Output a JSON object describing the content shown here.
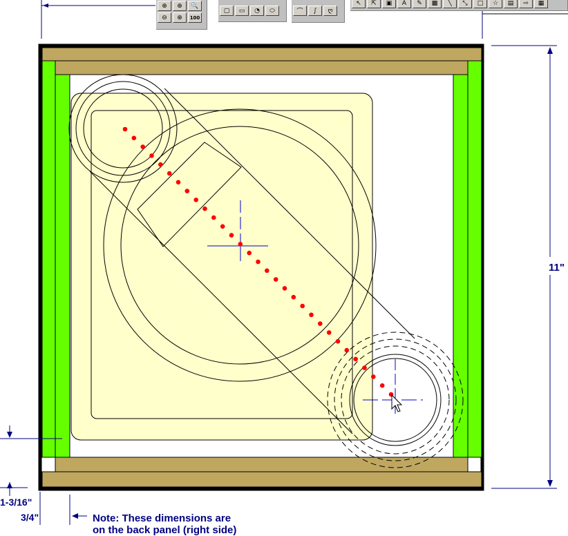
{
  "toolbars": {
    "zoom": [
      {
        "name": "zoom-in-icon",
        "glyph": "⊕"
      },
      {
        "name": "zoom-in-plus-icon",
        "glyph": "⊕"
      },
      {
        "name": "zoom-window-icon",
        "glyph": "🔍"
      },
      {
        "name": "zoom-out-icon",
        "glyph": "⊖"
      },
      {
        "name": "zoom-previous-icon",
        "glyph": "⊕"
      },
      {
        "name": "zoom-100-button",
        "glyph": "100"
      }
    ],
    "shapes": [
      {
        "name": "rectangle-tool-icon",
        "glyph": "▢"
      },
      {
        "name": "rounded-rectangle-tool-icon",
        "glyph": "▭"
      },
      {
        "name": "freeform-shape-tool-icon",
        "glyph": "◔"
      },
      {
        "name": "ellipse-tool-icon",
        "glyph": "⬭"
      }
    ],
    "curves": [
      {
        "name": "arc-tool-icon",
        "glyph": "⌒"
      },
      {
        "name": "spline-tool-icon",
        "glyph": "∫"
      },
      {
        "name": "spiral-tool-icon",
        "glyph": "ღ"
      }
    ],
    "tools": [
      {
        "name": "pointer-tool-icon",
        "glyph": "↖"
      },
      {
        "name": "reshape-tool-icon",
        "glyph": "⇱"
      },
      {
        "name": "duplicate-tool-icon",
        "glyph": "▣"
      },
      {
        "name": "text-tool-icon",
        "glyph": "A"
      },
      {
        "name": "symbol-tool-icon",
        "glyph": "✎"
      },
      {
        "name": "image-tool-icon",
        "glyph": "▩"
      },
      {
        "name": "line-tool-icon",
        "glyph": "╲"
      },
      {
        "name": "dimension-line-tool-icon",
        "glyph": "⤡"
      },
      {
        "name": "box-tool-icon",
        "glyph": "□"
      },
      {
        "name": "star-tool-icon",
        "glyph": "☆"
      },
      {
        "name": "page-tool-icon",
        "glyph": "▤"
      },
      {
        "name": "forward-tool-icon",
        "glyph": "⇨"
      },
      {
        "name": "grid-tool-icon",
        "glyph": "▦"
      }
    ]
  },
  "dimensions": {
    "height": "11\"",
    "offset_left": "1-3/16\"",
    "offset_small": "3/4\""
  },
  "note": {
    "line1": "Note: These dimensions are",
    "line2": "on the back panel (right side)"
  },
  "colors": {
    "wood": "#bfa760",
    "green": "#66ff00",
    "cream": "#ffffcc",
    "red_dots": "#ff0000",
    "crosshair": "#0000cc",
    "dimension": "#000080",
    "toolbar": "#c0c0c0"
  }
}
